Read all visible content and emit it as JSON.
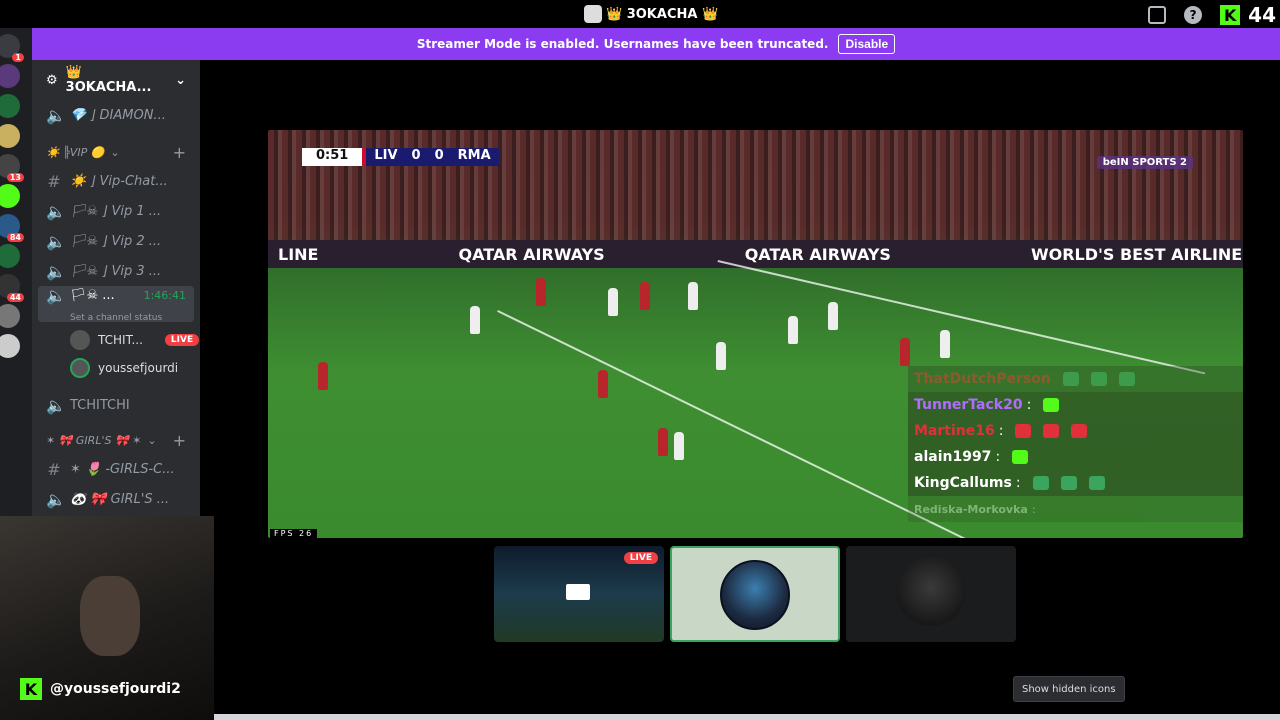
{
  "topbar": {
    "title": "👑 3OKACHA 👑",
    "kick_count": "44"
  },
  "banner": {
    "message": "Streamer Mode is enabled. Usernames have been truncated.",
    "disable_label": "Disable"
  },
  "rail": {
    "badges": [
      "1",
      "13",
      "84",
      "44"
    ]
  },
  "sidebar": {
    "server_name": "👑 3OKACHA...",
    "channels": [
      {
        "type": "voice",
        "label": "💎 ⌋ DIAMON..."
      },
      {
        "type": "category",
        "label": "☀️ ╠VIP 🟡"
      },
      {
        "type": "text",
        "label": "☀️ ⌋ Vip-Chat..."
      },
      {
        "type": "voice",
        "label": "🏳☠ ⌋ Vip 1 ..."
      },
      {
        "type": "voice",
        "label": "🏳☠ ⌋ Vip 2 ..."
      },
      {
        "type": "voice",
        "label": "🏳☠ ⌋ Vip 3 ..."
      }
    ],
    "active_channel": {
      "label": "🏳☠ ...",
      "timer": "1:46:41",
      "status": "Set a channel status"
    },
    "users": [
      {
        "name": "TCHIT...",
        "live": "LIVE"
      },
      {
        "name": "youssefjourdi"
      }
    ],
    "tchitchi": "TCHITCHI",
    "girls_category": "✶ 🎀 GIRL'S 🎀 ✶",
    "girls_text": "✶ 🌷 -GIRLS-C...",
    "girls_voice": "🐼 🎀 GIRL'S ..."
  },
  "webcam": {
    "handle": "@youssefjourdi2"
  },
  "video": {
    "clock": "0:51",
    "home": "LIV",
    "home_score": "0",
    "away_score": "0",
    "away": "RMA",
    "broadcaster": "beIN SPORTS 2",
    "fps": "FPS 26",
    "ads": [
      "LINE",
      "QATAR AIRWAYS",
      "QATAR AIRWAYS",
      "WORLD'S BEST AIRLINE"
    ]
  },
  "chat": [
    {
      "name": "ThatDutchPerson",
      "color": "#c0392b"
    },
    {
      "name": "TunnerTack20",
      "color": "#b06cff"
    },
    {
      "name": "Martine16",
      "color": "#e0303a"
    },
    {
      "name": "alain1997",
      "color": "#ffffff"
    },
    {
      "name": "KingCallums",
      "color": "#ffffff"
    },
    {
      "name": "Rediska-Morkovka",
      "color": "#cccccc"
    }
  ],
  "thumbs": {
    "live_label": "LIVE"
  },
  "show_hidden_icons": "Show hidden icons"
}
